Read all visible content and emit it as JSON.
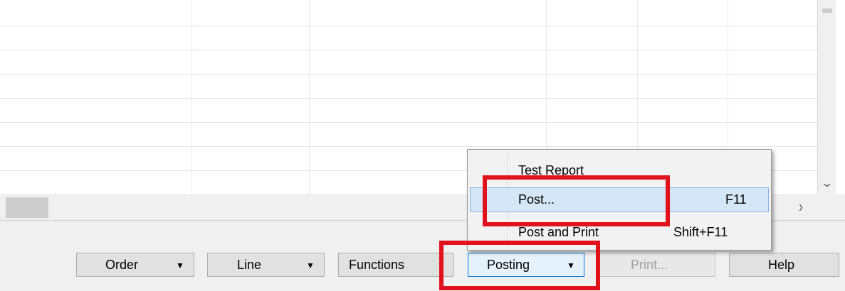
{
  "menu": {
    "items": [
      {
        "label": "Test Report",
        "shortcut": ""
      },
      {
        "label": "Post...",
        "shortcut": "F11"
      },
      {
        "label": "Post and Print",
        "shortcut": "Shift+F11"
      }
    ]
  },
  "buttons": {
    "order": "Order",
    "line": "Line",
    "functions": "Functions",
    "posting": "Posting",
    "print": "Print...",
    "help": "Help"
  },
  "icons": {
    "dropdown": "triangle-down",
    "scroll_down": "chevron-down",
    "scroll_right": "chevron-right"
  },
  "highlight_color": "#e0121b"
}
